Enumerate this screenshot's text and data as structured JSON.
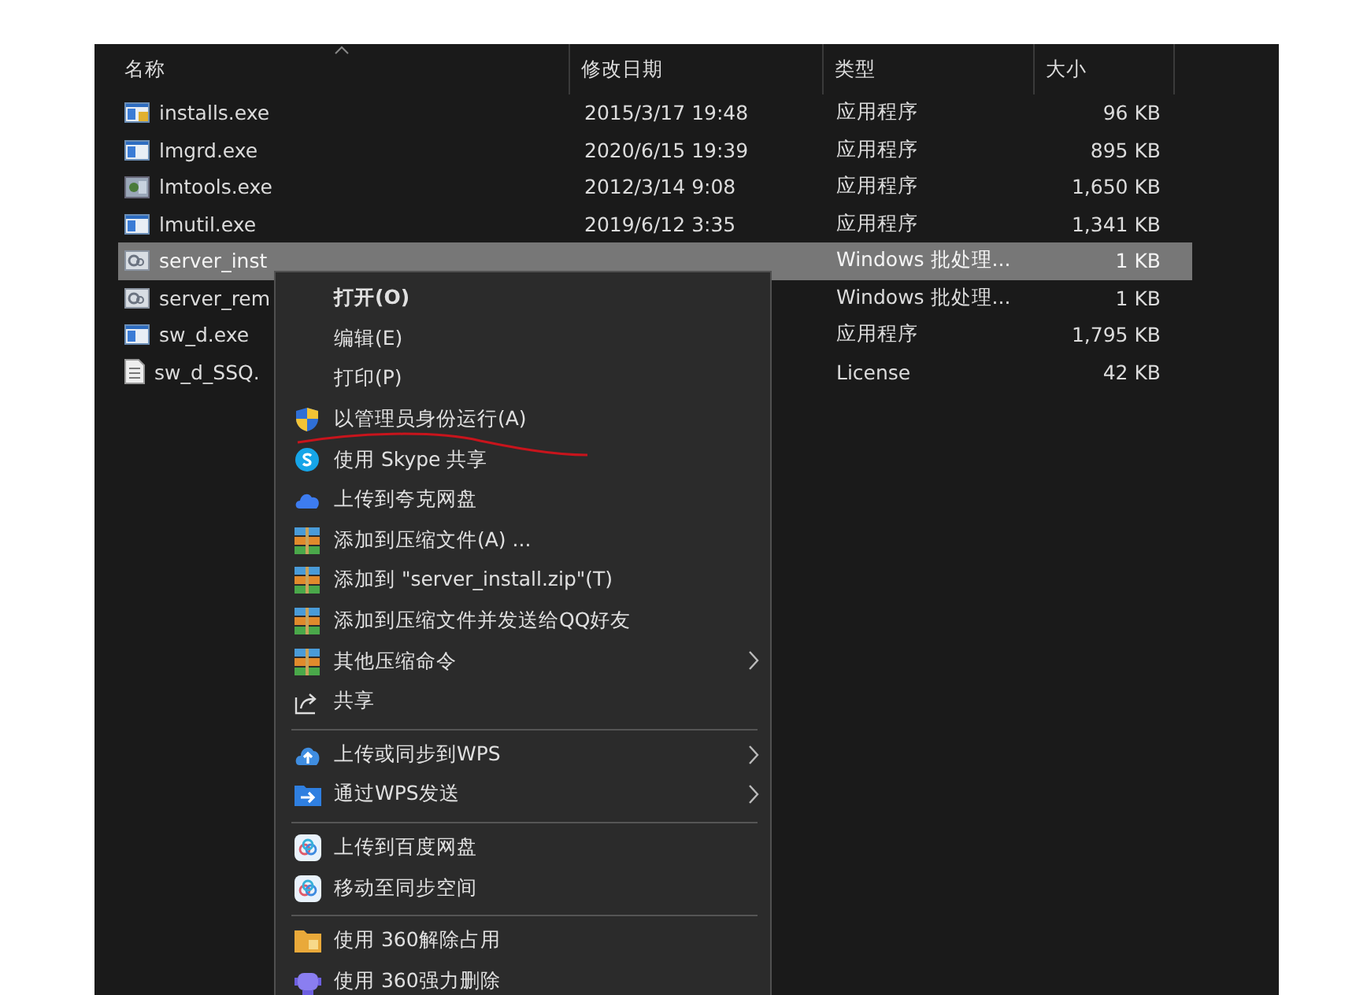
{
  "columns": [
    "名称",
    "修改日期",
    "类型",
    "大小"
  ],
  "files": [
    {
      "name": "installs.exe",
      "date": "2015/3/17 19:48",
      "type": "应用程序",
      "size": "96 KB",
      "selected": false
    },
    {
      "name": "lmgrd.exe",
      "date": "2020/6/15 19:39",
      "type": "应用程序",
      "size": "895 KB",
      "selected": false
    },
    {
      "name": "lmtools.exe",
      "date": "2012/3/14 9:08",
      "type": "应用程序",
      "size": "1,650 KB",
      "selected": false
    },
    {
      "name": "lmutil.exe",
      "date": "2019/6/12 3:35",
      "type": "应用程序",
      "size": "1,341 KB",
      "selected": false
    },
    {
      "name": "server_inst",
      "type": "Windows 批处理...",
      "size": "1 KB",
      "selected": true
    },
    {
      "name": "server_rem",
      "type": "Windows 批处理...",
      "size": "1 KB",
      "selected": false
    },
    {
      "name": "sw_d.exe",
      "type": "应用程序",
      "size": "1,795 KB",
      "selected": false
    },
    {
      "name": "sw_d_SSQ.",
      "type": "License",
      "size": "42 KB",
      "selected": false
    }
  ],
  "context_menu": {
    "groups": [
      [
        {
          "label": "打开(O)",
          "default": true,
          "submenu": false
        },
        {
          "label": "编辑(E)",
          "default": false,
          "submenu": false
        },
        {
          "label": "打印(P)",
          "default": false,
          "submenu": false
        },
        {
          "label": "以管理员身份运行(A)",
          "default": false,
          "submenu": false
        },
        {
          "label": "使用 Skype 共享",
          "default": false,
          "submenu": false
        },
        {
          "label": "上传到夸克网盘",
          "default": false,
          "submenu": false
        },
        {
          "label": "添加到压缩文件(A) ...",
          "default": false,
          "submenu": false
        },
        {
          "label": "添加到 \"server_install.zip\"(T)",
          "default": false,
          "submenu": false
        },
        {
          "label": "添加到压缩文件并发送给QQ好友",
          "default": false,
          "submenu": false
        },
        {
          "label": "其他压缩命令",
          "default": false,
          "submenu": true
        },
        {
          "label": "共享",
          "default": false,
          "submenu": false
        }
      ],
      [
        {
          "label": "上传或同步到WPS",
          "default": false,
          "submenu": true
        },
        {
          "label": "通过WPS发送",
          "default": false,
          "submenu": true
        }
      ],
      [
        {
          "label": "上传到百度网盘",
          "default": false,
          "submenu": false
        },
        {
          "label": "移动至同步空间",
          "default": false,
          "submenu": false
        }
      ],
      [
        {
          "label": "使用 360解除占用",
          "default": false,
          "submenu": false
        },
        {
          "label": "使用 360强力删除",
          "default": false,
          "submenu": false
        }
      ]
    ]
  }
}
